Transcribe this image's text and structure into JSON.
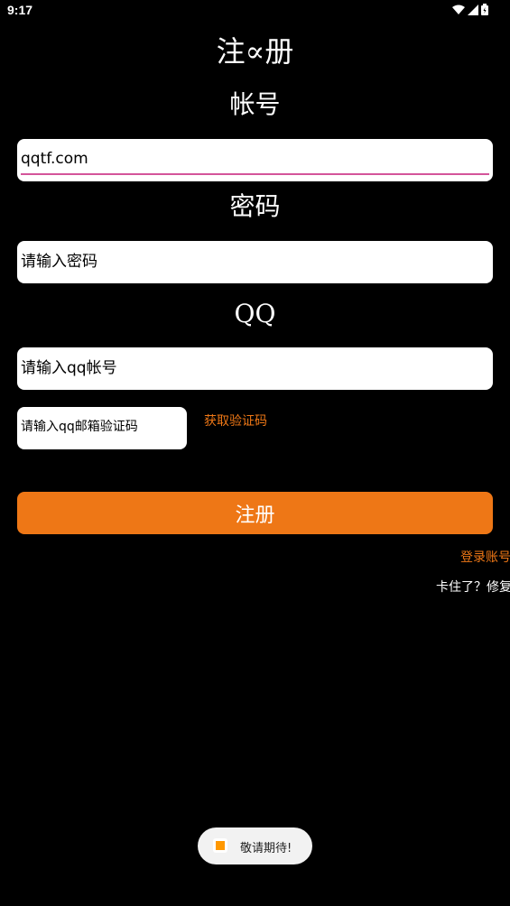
{
  "status_bar": {
    "time": "9:17",
    "icons": [
      "wifi-icon",
      "signal-icon",
      "battery-icon"
    ]
  },
  "page": {
    "title": "注∝册"
  },
  "account": {
    "label": "帐号",
    "value": "qqtf.com"
  },
  "password": {
    "label": "密码",
    "placeholder": "请输入密码"
  },
  "qq": {
    "label": "QQ",
    "placeholder": "请输入qq帐号"
  },
  "verification": {
    "placeholder": "请输入qq邮箱验证码",
    "get_code_label": "获取验证码"
  },
  "register_button": {
    "label": "注册"
  },
  "links": {
    "login": "登录账号",
    "stuck": "卡住了？修复"
  },
  "toast": {
    "text": "敬请期待!"
  },
  "colors": {
    "background": "#000000",
    "accent": "#ee7716",
    "input_underline": "#d4559a",
    "toast_icon": "#ff9800"
  }
}
